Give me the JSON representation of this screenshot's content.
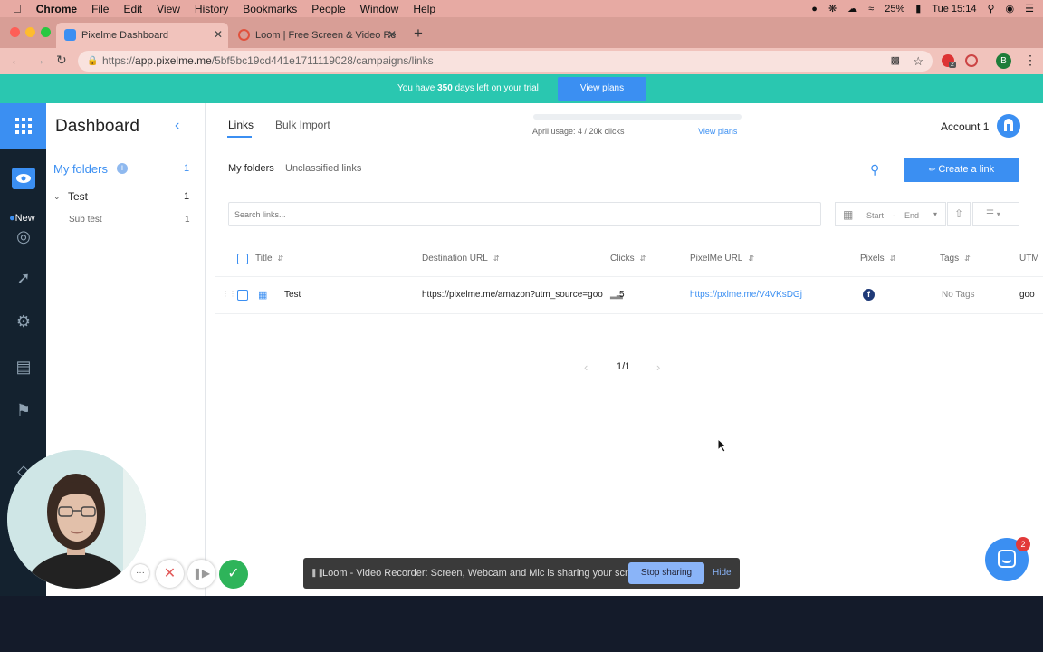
{
  "macos": {
    "app_name": "Chrome",
    "menus": [
      "File",
      "Edit",
      "View",
      "History",
      "Bookmarks",
      "People",
      "Window",
      "Help"
    ],
    "battery": "25%",
    "clock": "Tue 15:14"
  },
  "browser": {
    "tabs": [
      {
        "title": "Pixelme Dashboard"
      },
      {
        "title": "Loom | Free Screen & Video Re"
      }
    ],
    "url_prefix": "https://",
    "url_host": "app.pixelme.me",
    "url_path": "/5bf5bc19cd441e1711119028/campaigns/links",
    "profile_initial": "B",
    "extension_badge": "2"
  },
  "trial": {
    "text_before": "You have ",
    "days": "350",
    "text_after": " days left on your trial",
    "button": "View plans"
  },
  "rail": {
    "new_label": "New"
  },
  "sidebar": {
    "title": "Dashboard",
    "my_folders": "My folders",
    "my_folders_count": "1",
    "folders": [
      {
        "name": "Test",
        "count": "1"
      },
      {
        "name": "Sub test",
        "count": "1"
      }
    ]
  },
  "header": {
    "tabs": [
      "Links",
      "Bulk Import"
    ],
    "usage_text": "April usage: 4 / 20k clicks",
    "usage_fraction": 0.0002,
    "view_plans": "View plans",
    "account": "Account 1"
  },
  "subnav": {
    "items": [
      "My folders",
      "Unclassified links"
    ],
    "create_button": "Create a link"
  },
  "filters": {
    "search_placeholder": "Search links...",
    "start": "Start",
    "end": "End"
  },
  "table": {
    "columns": [
      "Title",
      "Destination URL",
      "Clicks",
      "PixelMe URL",
      "Pixels",
      "Tags",
      "UTM"
    ],
    "rows": [
      {
        "title": "Test",
        "destination": "https://pixelme.me/amazon?utm_source=goo",
        "clicks": "5",
        "pixelme_url": "https://pxlme.me/V4VKsDGj",
        "pixel": "f",
        "tags": "No Tags",
        "utm": "goo"
      }
    ]
  },
  "pagination": {
    "label": "1/1"
  },
  "loom": {
    "message": "Loom - Video Recorder: Screen, Webcam and Mic is sharing your screen.",
    "stop": "Stop sharing",
    "hide": "Hide",
    "more": "···"
  },
  "chat": {
    "badge": "2"
  },
  "colors": {
    "accent": "#3b8ff2",
    "teal": "#2ac7b0",
    "rail": "#14222f",
    "titlebar": "#d89e96"
  }
}
